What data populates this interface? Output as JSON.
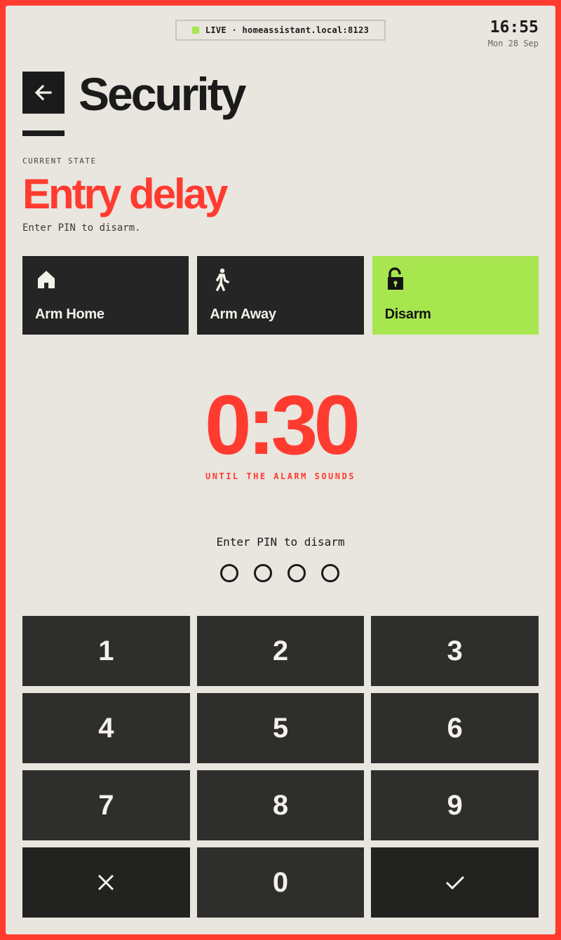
{
  "status_bar": {
    "live_text": "LIVE · homeassistant.local:8123",
    "time": "16:55",
    "date": "Mon 28 Sep"
  },
  "header": {
    "back_icon": "arrow-left-icon",
    "title": "Security"
  },
  "state": {
    "label": "CURRENT STATE",
    "value": "Entry delay",
    "hint": "Enter PIN to disarm."
  },
  "modes": [
    {
      "label": "Arm Home",
      "icon": "home-icon",
      "active": false
    },
    {
      "label": "Arm Away",
      "icon": "walking-person-icon",
      "active": false
    },
    {
      "label": "Disarm",
      "icon": "unlocked-padlock-icon",
      "active": true
    }
  ],
  "countdown": {
    "value": "0:30",
    "caption": "UNTIL THE ALARM SOUNDS"
  },
  "pin": {
    "prompt": "Enter PIN to disarm",
    "digits_entered": 0,
    "length": 4
  },
  "keypad": {
    "keys": [
      "1",
      "2",
      "3",
      "4",
      "5",
      "6",
      "7",
      "8",
      "9",
      "0"
    ],
    "clear_icon": "close-icon",
    "confirm_icon": "checkmark-icon"
  },
  "colors": {
    "accent": "#ff3b30",
    "active": "#a8e64f",
    "background": "#e9e5df",
    "dark": "#1b1b1b"
  }
}
